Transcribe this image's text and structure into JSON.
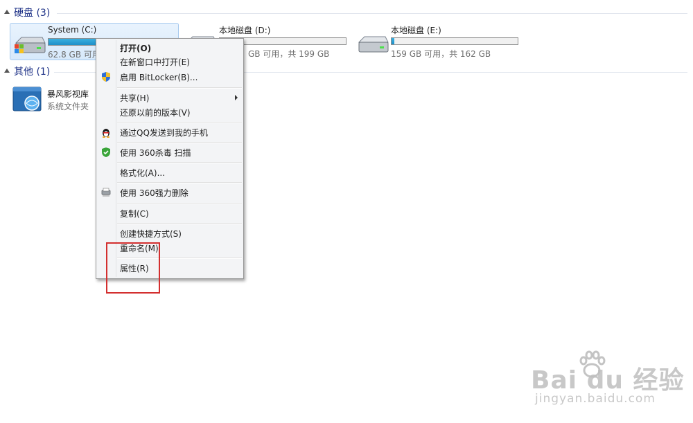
{
  "groups": {
    "hard_disks": {
      "title": "硬盘 (3)"
    },
    "other": {
      "title": "其他 (1)"
    }
  },
  "drives": [
    {
      "name": "System (C:)",
      "free_text": "62.8 GB 可用",
      "used_fraction": 0.68,
      "bar_color": "#26a0da",
      "selected": true
    },
    {
      "name": "本地磁盘 (D:)",
      "free_text": "GB 可用，共 199 GB",
      "used_fraction": 0.02,
      "bar_color": "#26a0da",
      "selected": false
    },
    {
      "name": "本地磁盘 (E:)",
      "free_text": "159 GB 可用，共 162 GB",
      "used_fraction": 0.02,
      "bar_color": "#26a0da",
      "selected": false
    }
  ],
  "other_items": [
    {
      "name": "暴风影视库",
      "type": "系统文件夹"
    }
  ],
  "context_menu": {
    "items": [
      {
        "label": "打开(O)",
        "bold": true,
        "icon": "",
        "submenu": false
      },
      {
        "label": "在新窗口中打开(E)",
        "icon": "",
        "submenu": false
      },
      {
        "label": "启用 BitLocker(B)...",
        "icon": "uac-shield-icon",
        "submenu": false
      },
      {
        "label": "共享(H)",
        "icon": "",
        "submenu": true
      },
      {
        "label": "还原以前的版本(V)",
        "icon": "",
        "submenu": false
      },
      {
        "label": "通过QQ发送到我的手机",
        "icon": "qq-penguin-icon",
        "submenu": false
      },
      {
        "label": "使用 360杀毒 扫描",
        "icon": "360-shield-icon",
        "submenu": false
      },
      {
        "label": "格式化(A)...",
        "icon": "",
        "submenu": false
      },
      {
        "label": "使用 360强力删除",
        "icon": "shredder-icon",
        "submenu": false
      },
      {
        "label": "复制(C)",
        "icon": "",
        "submenu": false
      },
      {
        "label": "创建快捷方式(S)",
        "icon": "",
        "submenu": false
      },
      {
        "label": "重命名(M)",
        "icon": "",
        "submenu": false
      },
      {
        "label": "属性(R)",
        "icon": "",
        "submenu": false
      }
    ]
  },
  "watermark": {
    "logo_text": "Bai du 经验",
    "url": "jingyan.baidu.com"
  },
  "colors": {
    "accent": "#26a0da",
    "group_title": "#1e3287",
    "highlight_box": "#d32f2f"
  }
}
